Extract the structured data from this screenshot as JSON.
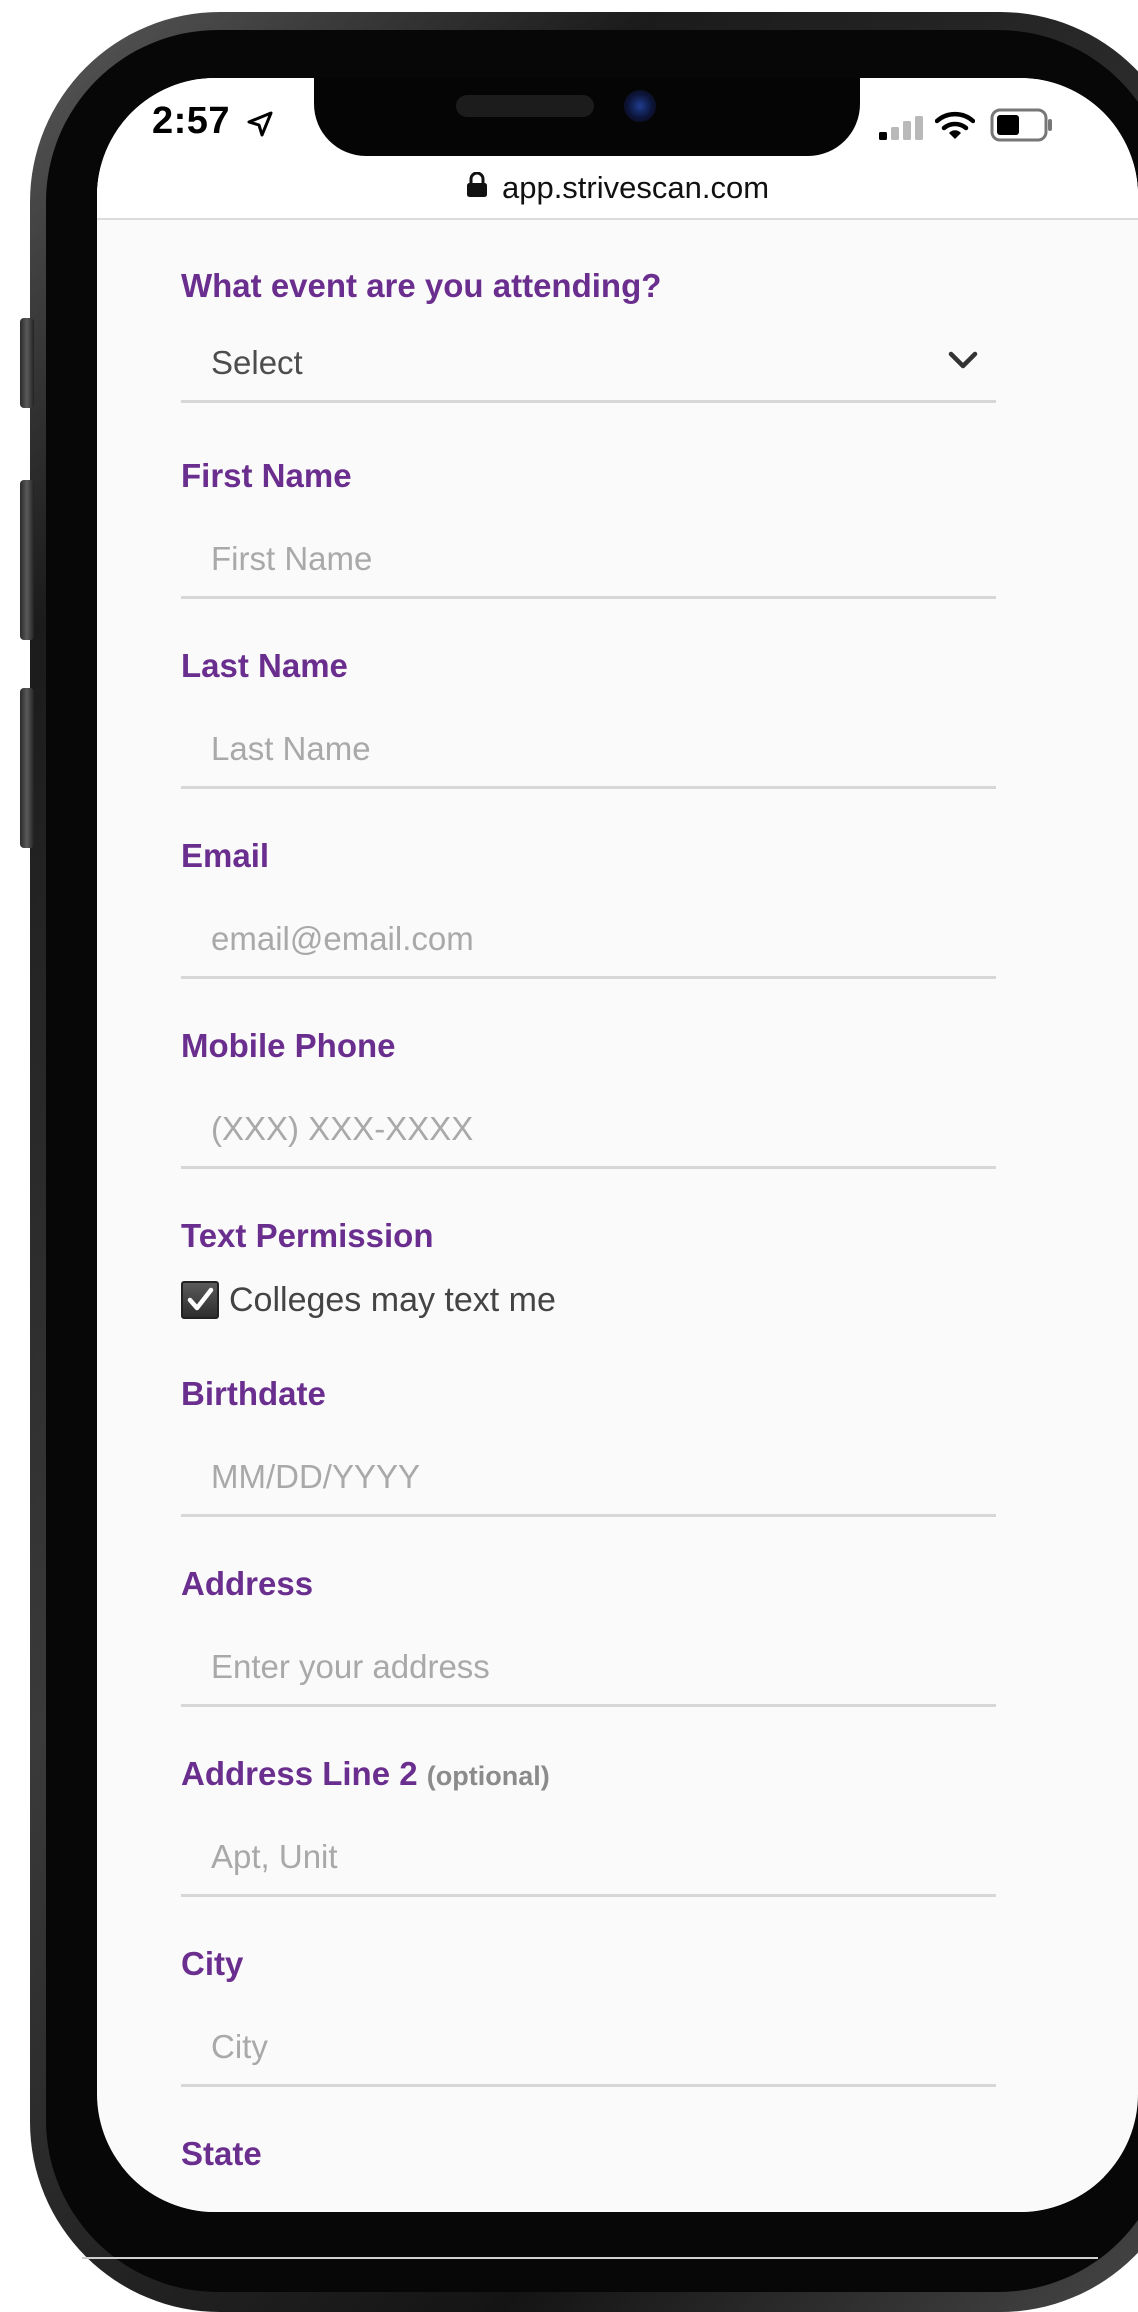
{
  "status_bar": {
    "time": "2:57",
    "icons": [
      "location-arrow-icon",
      "cellular-signal-icon",
      "wifi-icon",
      "battery-icon"
    ]
  },
  "browser": {
    "url": "app.strivescan.com",
    "lock_icon": "lock-icon"
  },
  "form": {
    "event": {
      "label": "What event are you attending?",
      "value": "Select",
      "icon": "chevron-down-icon"
    },
    "first_name": {
      "label": "First Name",
      "placeholder": "First Name"
    },
    "last_name": {
      "label": "Last Name",
      "placeholder": "Last Name"
    },
    "email": {
      "label": "Email",
      "placeholder": "email@email.com"
    },
    "mobile_phone": {
      "label": "Mobile Phone",
      "placeholder": "(XXX) XXX-XXXX"
    },
    "text_permission": {
      "label": "Text Permission",
      "checkbox_label": "Colleges may text me",
      "checked": true
    },
    "birthdate": {
      "label": "Birthdate",
      "placeholder": "MM/DD/YYYY"
    },
    "address": {
      "label": "Address",
      "placeholder": "Enter your address"
    },
    "address_line_2": {
      "label": "Address Line 2",
      "optional": "(optional)",
      "placeholder": "Apt, Unit"
    },
    "city": {
      "label": "City",
      "placeholder": "City"
    },
    "state": {
      "label": "State"
    }
  },
  "colors": {
    "label_purple": "#6a2e8e",
    "placeholder_gray": "#a9a9a9",
    "underline_gray": "#d7d7d7",
    "page_background": "#fbfafb"
  }
}
